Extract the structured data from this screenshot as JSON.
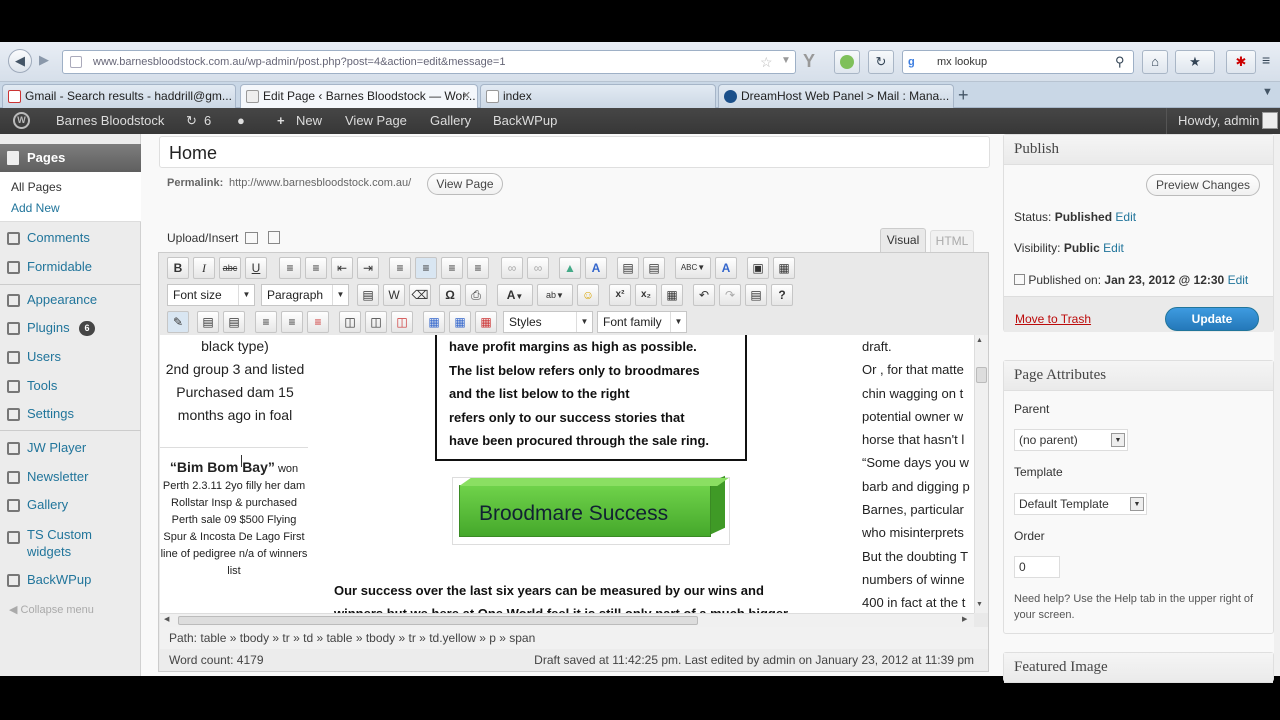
{
  "browser": {
    "url": "www.barnesbloodstock.com.au/wp-admin/post.php?post=4&action=edit&message=1",
    "search_text": "mx lookup",
    "tabs": [
      {
        "label": "Gmail - Search results - haddrill@gm...",
        "icon": "gmail-icon"
      },
      {
        "label": "Edit Page ‹ Barnes Bloodstock — Wor...",
        "icon": "wordpress-icon"
      },
      {
        "label": "index",
        "icon": "page-icon"
      },
      {
        "label": "DreamHost Web Panel > Mail : Mana...",
        "icon": "dreamhost-icon"
      }
    ],
    "new_tab": "+"
  },
  "adminbar": {
    "site": "Barnes Bloodstock",
    "updates": "6",
    "new": "New",
    "view_page": "View Page",
    "gallery": "Gallery",
    "backwpup": "BackWPup",
    "howdy": "Howdy, admin"
  },
  "sidebar": {
    "pages": "Pages",
    "all_pages": "All Pages",
    "add_new": "Add New",
    "items": [
      {
        "label": "Comments",
        "icon": "comments-icon"
      },
      {
        "label": "Formidable",
        "icon": "formidable-icon"
      },
      {
        "label": "Appearance",
        "icon": "appearance-icon"
      },
      {
        "label": "Plugins",
        "icon": "plugins-icon",
        "badge": "6"
      },
      {
        "label": "Users",
        "icon": "users-icon"
      },
      {
        "label": "Tools",
        "icon": "tools-icon"
      },
      {
        "label": "Settings",
        "icon": "settings-icon"
      },
      {
        "label": "JW Player",
        "icon": "jwplayer-icon"
      },
      {
        "label": "Newsletter",
        "icon": "newsletter-icon"
      },
      {
        "label": "Gallery",
        "icon": "gallery-icon"
      },
      {
        "label": "TS Custom widgets",
        "icon": "widgets-icon"
      },
      {
        "label": "BackWPup",
        "icon": "backwpup-icon"
      }
    ],
    "collapse": "Collapse menu"
  },
  "editor": {
    "title": "Home",
    "permalink_label": "Permalink:",
    "permalink_url": "http://www.barnesbloodstock.com.au/",
    "view_page_btn": "View Page",
    "upload_insert": "Upload/Insert",
    "tab_visual": "Visual",
    "tab_html": "HTML",
    "font_size": "Font size",
    "format": "Paragraph",
    "styles": "Styles",
    "font_family": "Font family",
    "content": {
      "left_lines": [
        "black type)",
        "2nd group 3 and listed",
        "Purchased dam 15",
        "months ago in foal"
      ],
      "bim_title": "“Bim Bom Bay”",
      "bim_won": "won",
      "bim_text": "Perth 2.3.11 2yo filly her dam Rollstar Insp & purchased Perth sale 09 $500 Flying Spur & Incosta De Lago First line of pedigree n/a of winners list",
      "box_lines": [
        "have profit margins as high as possible.",
        "The list below refers only to broodmares",
        "and the list below to the right",
        "refers only to our success stories that",
        "have been procured through the sale ring."
      ],
      "banner": "Broodmare Success",
      "bottom_line1": "Our success over the last six years can be measured by our wins and",
      "bottom_line2": "winners but we here at One World feel it is still only part of a much bigger",
      "right_lines": [
        "draft.",
        "Or , for that matte",
        "chin wagging on t",
        "potential owner w",
        "horse that hasn't l",
        "“Some days you w",
        "barb and digging p",
        "Barnes, particular",
        "who misinterprets",
        "But the doubting T",
        "numbers of winne",
        "400 in fact at the t"
      ]
    },
    "path_label": "Path:",
    "path": "table » tbody » tr » td » table » tbody » tr » td.yellow » p » span",
    "word_count": "Word count: 4179",
    "draft_status": "Draft saved at 11:42:25 pm. Last edited by admin on January 23, 2012 at 11:39 pm"
  },
  "publish": {
    "title": "Publish",
    "preview_btn": "Preview Changes",
    "status_label": "Status:",
    "status_value": "Published",
    "visibility_label": "Visibility:",
    "visibility_value": "Public",
    "published_label": "Published on:",
    "published_value": "Jan 23, 2012 @ 12:30",
    "edit": "Edit",
    "trash": "Move to Trash",
    "update_btn": "Update"
  },
  "attributes": {
    "title": "Page Attributes",
    "parent_label": "Parent",
    "parent_value": "(no parent)",
    "template_label": "Template",
    "template_value": "Default Template",
    "order_label": "Order",
    "order_value": "0",
    "help": "Need help? Use the Help tab in the upper right of your screen."
  },
  "featured": {
    "title": "Featured Image"
  },
  "colors": {
    "accent": "#21759b",
    "update_btn": "#2e8ac9",
    "trash": "#bc0b0b",
    "banner_green": "#5bbf33"
  }
}
